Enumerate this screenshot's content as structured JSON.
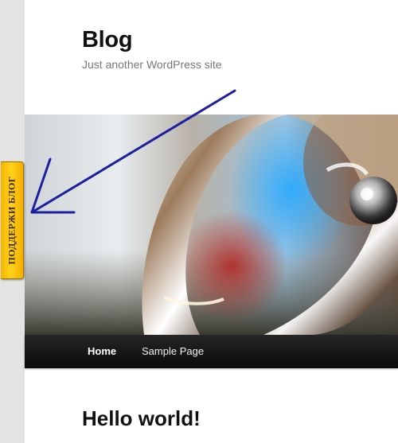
{
  "site": {
    "title": "Blog",
    "description": "Just another WordPress site"
  },
  "nav": {
    "items": [
      {
        "label": "Home"
      },
      {
        "label": "Sample Page"
      }
    ]
  },
  "post": {
    "title": "Hello world!"
  },
  "support_tab": {
    "label": "ПОДДЕРЖИ БЛОГ",
    "color": "#f5b400"
  },
  "annotation": {
    "arrow_color": "#1b1fa0"
  },
  "colors": {
    "nav_background": "#111111",
    "left_rail": "#e3e3e3"
  }
}
